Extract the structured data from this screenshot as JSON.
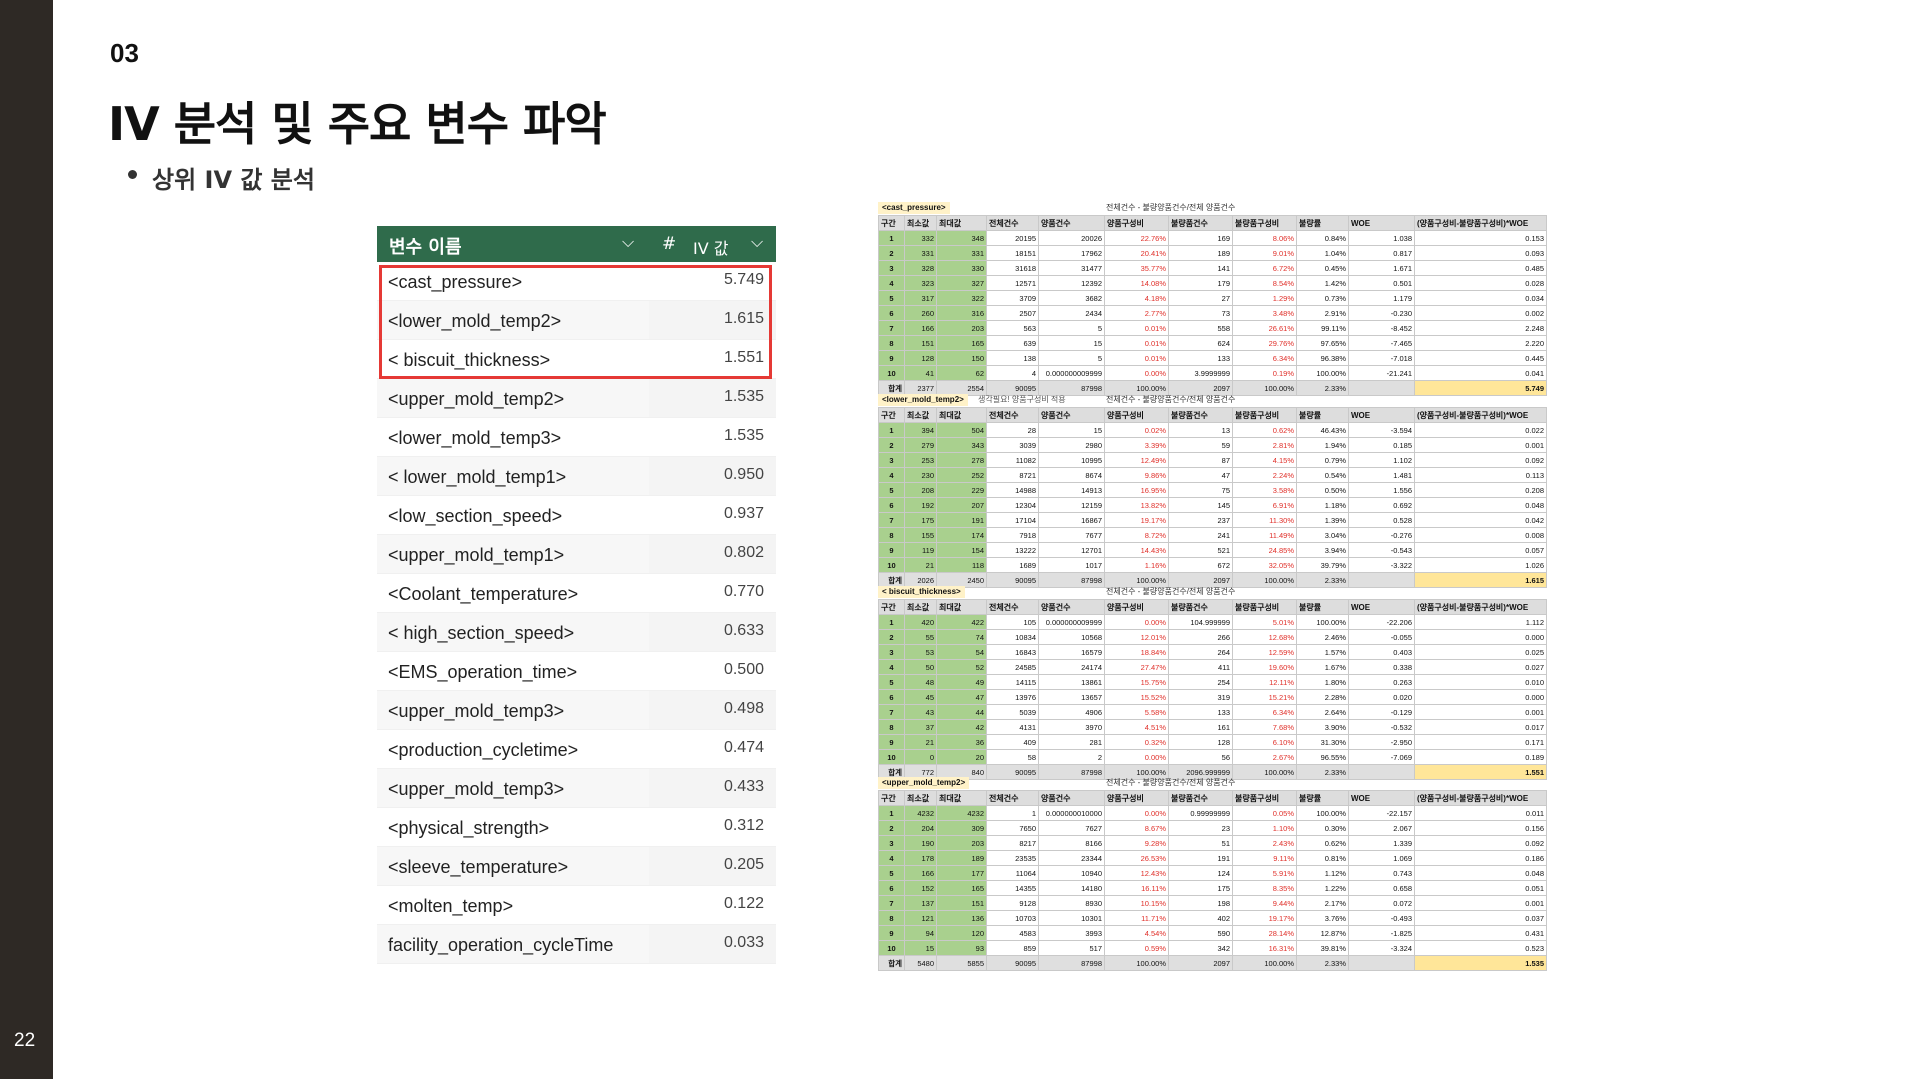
{
  "page": {
    "number": "22",
    "section": "03",
    "title": "IV 분석 및 주요 변수 파악",
    "bullet": "상위 IV 값 분석"
  },
  "iv_table": {
    "header": {
      "name": "변수 이름",
      "hash": "#",
      "value": "IV 값"
    },
    "rows": [
      {
        "name": "<cast_pressure>",
        "value": "5.749"
      },
      {
        "name": "<lower_mold_temp2>",
        "value": "1.615"
      },
      {
        "name": "< biscuit_thickness>",
        "value": "1.551"
      },
      {
        "name": "<upper_mold_temp2>",
        "value": "1.535"
      },
      {
        "name": "<lower_mold_temp3>",
        "value": "1.535"
      },
      {
        "name": "< lower_mold_temp1>",
        "value": "0.950"
      },
      {
        "name": "<low_section_speed>",
        "value": "0.937"
      },
      {
        "name": "<upper_mold_temp1>",
        "value": "0.802"
      },
      {
        "name": "<Coolant_temperature>",
        "value": "0.770"
      },
      {
        "name": "< high_section_speed>",
        "value": "0.633"
      },
      {
        "name": "<EMS_operation_time>",
        "value": "0.500"
      },
      {
        "name": "<upper_mold_temp3>",
        "value": "0.498"
      },
      {
        "name": "<production_cycletime>",
        "value": "0.474"
      },
      {
        "name": "<upper_mold_temp3>",
        "value": "0.433"
      },
      {
        "name": "<physical_strength>",
        "value": "0.312"
      },
      {
        "name": "<sleeve_temperature>",
        "value": "0.205"
      },
      {
        "name": "<molten_temp>",
        "value": "0.122"
      },
      {
        "name": "facility_operation_cycleTime",
        "value": "0.033"
      }
    ]
  },
  "sheet": {
    "columns": [
      "구간",
      "최소값",
      "최대값",
      "전체건수",
      "양품건수",
      "양품구성비",
      "불량품건수",
      "불량품구성비",
      "불량률",
      "WOE",
      "(양품구성비-불량품구성비)*WOE"
    ],
    "blocks": [
      {
        "title": "<cast_pressure>",
        "note": "전체건수 - 불량양품건수/전체 양품건수",
        "note2": "",
        "rows": [
          [
            "1",
            "332",
            "348",
            "20195",
            "20026",
            "22.76%",
            "169",
            "8.06%",
            "0.84%",
            "1.038",
            "0.153"
          ],
          [
            "2",
            "331",
            "331",
            "18151",
            "17962",
            "20.41%",
            "189",
            "9.01%",
            "1.04%",
            "0.817",
            "0.093"
          ],
          [
            "3",
            "328",
            "330",
            "31618",
            "31477",
            "35.77%",
            "141",
            "6.72%",
            "0.45%",
            "1.671",
            "0.485"
          ],
          [
            "4",
            "323",
            "327",
            "12571",
            "12392",
            "14.08%",
            "179",
            "8.54%",
            "1.42%",
            "0.501",
            "0.028"
          ],
          [
            "5",
            "317",
            "322",
            "3709",
            "3682",
            "4.18%",
            "27",
            "1.29%",
            "0.73%",
            "1.179",
            "0.034"
          ],
          [
            "6",
            "260",
            "316",
            "2507",
            "2434",
            "2.77%",
            "73",
            "3.48%",
            "2.91%",
            "-0.230",
            "0.002"
          ],
          [
            "7",
            "166",
            "203",
            "563",
            "5",
            "0.01%",
            "558",
            "26.61%",
            "99.11%",
            "-8.452",
            "2.248"
          ],
          [
            "8",
            "151",
            "165",
            "639",
            "15",
            "0.01%",
            "624",
            "29.76%",
            "97.65%",
            "-7.465",
            "2.220"
          ],
          [
            "9",
            "128",
            "150",
            "138",
            "5",
            "0.01%",
            "133",
            "6.34%",
            "96.38%",
            "-7.018",
            "0.445"
          ],
          [
            "10",
            "41",
            "62",
            "4",
            "0.000000009999",
            "0.00%",
            "3.9999999",
            "0.19%",
            "100.00%",
            "-21.241",
            "0.041"
          ]
        ],
        "total": [
          "합계",
          "2377",
          "2554",
          "90095",
          "87998",
          "100.00%",
          "2097",
          "100.00%",
          "2.33%",
          "",
          "5.749"
        ]
      },
      {
        "title": "<lower_mold_temp2>",
        "note": "전체건수 - 불량양품건수/전체 양품건수",
        "note2": "생각필요! 양품구성비 적용",
        "rows": [
          [
            "1",
            "394",
            "504",
            "28",
            "15",
            "0.02%",
            "13",
            "0.62%",
            "46.43%",
            "-3.594",
            "0.022"
          ],
          [
            "2",
            "279",
            "343",
            "3039",
            "2980",
            "3.39%",
            "59",
            "2.81%",
            "1.94%",
            "0.185",
            "0.001"
          ],
          [
            "3",
            "253",
            "278",
            "11082",
            "10995",
            "12.49%",
            "87",
            "4.15%",
            "0.79%",
            "1.102",
            "0.092"
          ],
          [
            "4",
            "230",
            "252",
            "8721",
            "8674",
            "9.86%",
            "47",
            "2.24%",
            "0.54%",
            "1.481",
            "0.113"
          ],
          [
            "5",
            "208",
            "229",
            "14988",
            "14913",
            "16.95%",
            "75",
            "3.58%",
            "0.50%",
            "1.556",
            "0.208"
          ],
          [
            "6",
            "192",
            "207",
            "12304",
            "12159",
            "13.82%",
            "145",
            "6.91%",
            "1.18%",
            "0.692",
            "0.048"
          ],
          [
            "7",
            "175",
            "191",
            "17104",
            "16867",
            "19.17%",
            "237",
            "11.30%",
            "1.39%",
            "0.528",
            "0.042"
          ],
          [
            "8",
            "155",
            "174",
            "7918",
            "7677",
            "8.72%",
            "241",
            "11.49%",
            "3.04%",
            "-0.276",
            "0.008"
          ],
          [
            "9",
            "119",
            "154",
            "13222",
            "12701",
            "14.43%",
            "521",
            "24.85%",
            "3.94%",
            "-0.543",
            "0.057"
          ],
          [
            "10",
            "21",
            "118",
            "1689",
            "1017",
            "1.16%",
            "672",
            "32.05%",
            "39.79%",
            "-3.322",
            "1.026"
          ]
        ],
        "total": [
          "합계",
          "2026",
          "2450",
          "90095",
          "87998",
          "100.00%",
          "2097",
          "100.00%",
          "2.33%",
          "",
          "1.615"
        ]
      },
      {
        "title": "< biscuit_thickness>",
        "note": "전체건수 - 불량양품건수/전체 양품건수",
        "note2": "",
        "rows": [
          [
            "1",
            "420",
            "422",
            "105",
            "0.000000009999",
            "0.00%",
            "104.999999",
            "5.01%",
            "100.00%",
            "-22.206",
            "1.112"
          ],
          [
            "2",
            "55",
            "74",
            "10834",
            "10568",
            "12.01%",
            "266",
            "12.68%",
            "2.46%",
            "-0.055",
            "0.000"
          ],
          [
            "3",
            "53",
            "54",
            "16843",
            "16579",
            "18.84%",
            "264",
            "12.59%",
            "1.57%",
            "0.403",
            "0.025"
          ],
          [
            "4",
            "50",
            "52",
            "24585",
            "24174",
            "27.47%",
            "411",
            "19.60%",
            "1.67%",
            "0.338",
            "0.027"
          ],
          [
            "5",
            "48",
            "49",
            "14115",
            "13861",
            "15.75%",
            "254",
            "12.11%",
            "1.80%",
            "0.263",
            "0.010"
          ],
          [
            "6",
            "45",
            "47",
            "13976",
            "13657",
            "15.52%",
            "319",
            "15.21%",
            "2.28%",
            "0.020",
            "0.000"
          ],
          [
            "7",
            "43",
            "44",
            "5039",
            "4906",
            "5.58%",
            "133",
            "6.34%",
            "2.64%",
            "-0.129",
            "0.001"
          ],
          [
            "8",
            "37",
            "42",
            "4131",
            "3970",
            "4.51%",
            "161",
            "7.68%",
            "3.90%",
            "-0.532",
            "0.017"
          ],
          [
            "9",
            "21",
            "36",
            "409",
            "281",
            "0.32%",
            "128",
            "6.10%",
            "31.30%",
            "-2.950",
            "0.171"
          ],
          [
            "10",
            "0",
            "20",
            "58",
            "2",
            "0.00%",
            "56",
            "2.67%",
            "96.55%",
            "-7.069",
            "0.189"
          ]
        ],
        "total": [
          "합계",
          "772",
          "840",
          "90095",
          "87998",
          "100.00%",
          "2096.999999",
          "100.00%",
          "2.33%",
          "",
          "1.551"
        ]
      },
      {
        "title": "<upper_mold_temp2>",
        "note": "전체건수 - 불량양품건수/전체 양품건수",
        "note2": "",
        "rows": [
          [
            "1",
            "4232",
            "4232",
            "1",
            "0.000000010000",
            "0.00%",
            "0.99999999",
            "0.05%",
            "100.00%",
            "-22.157",
            "0.011"
          ],
          [
            "2",
            "204",
            "309",
            "7650",
            "7627",
            "8.67%",
            "23",
            "1.10%",
            "0.30%",
            "2.067",
            "0.156"
          ],
          [
            "3",
            "190",
            "203",
            "8217",
            "8166",
            "9.28%",
            "51",
            "2.43%",
            "0.62%",
            "1.339",
            "0.092"
          ],
          [
            "4",
            "178",
            "189",
            "23535",
            "23344",
            "26.53%",
            "191",
            "9.11%",
            "0.81%",
            "1.069",
            "0.186"
          ],
          [
            "5",
            "166",
            "177",
            "11064",
            "10940",
            "12.43%",
            "124",
            "5.91%",
            "1.12%",
            "0.743",
            "0.048"
          ],
          [
            "6",
            "152",
            "165",
            "14355",
            "14180",
            "16.11%",
            "175",
            "8.35%",
            "1.22%",
            "0.658",
            "0.051"
          ],
          [
            "7",
            "137",
            "151",
            "9128",
            "8930",
            "10.15%",
            "198",
            "9.44%",
            "2.17%",
            "0.072",
            "0.001"
          ],
          [
            "8",
            "121",
            "136",
            "10703",
            "10301",
            "11.71%",
            "402",
            "19.17%",
            "3.76%",
            "-0.493",
            "0.037"
          ],
          [
            "9",
            "94",
            "120",
            "4583",
            "3993",
            "4.54%",
            "590",
            "28.14%",
            "12.87%",
            "-1.825",
            "0.431"
          ],
          [
            "10",
            "15",
            "93",
            "859",
            "517",
            "0.59%",
            "342",
            "16.31%",
            "39.81%",
            "-3.324",
            "0.523"
          ]
        ],
        "total": [
          "합계",
          "5480",
          "5855",
          "90095",
          "87998",
          "100.00%",
          "2097",
          "100.00%",
          "2.33%",
          "",
          "1.535"
        ]
      }
    ]
  }
}
